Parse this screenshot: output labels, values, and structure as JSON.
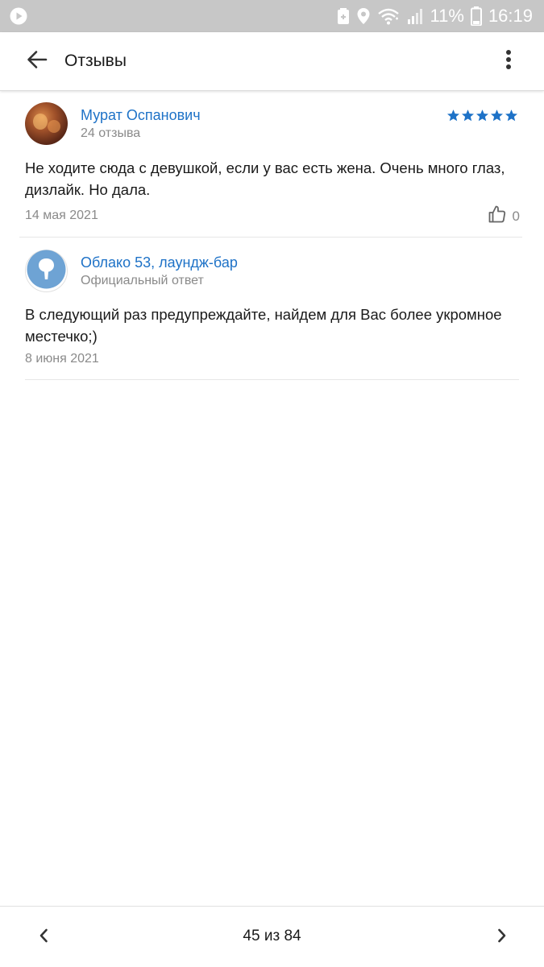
{
  "status_bar": {
    "battery_percent": "11%",
    "time": "16:19",
    "icons": [
      "play-icon",
      "battery-saver-icon",
      "location-icon",
      "wifi-icon",
      "signal-icon",
      "battery-icon"
    ]
  },
  "header": {
    "title": "Отзывы",
    "back_icon": "arrow-left-icon",
    "menu_icon": "more-vertical-icon"
  },
  "review": {
    "author_name": "Мурат Оспанович",
    "author_reviews_count": "24 отзыва",
    "rating": 5,
    "rating_max": 5,
    "text": "Не ходите сюда с девушкой, если у вас есть жена. Очень много глаз, дизлайк. Но дала.",
    "date": "14 мая 2021",
    "likes": "0",
    "like_icon": "thumbs-up-icon"
  },
  "response": {
    "org_name": "Облако 53, лаундж-бар",
    "label": "Официальный ответ",
    "text": "В следующий раз предупреждайте, найдем для Вас более укромное местечко;)",
    "date": "8 июня 2021"
  },
  "pagination": {
    "text": "45 из 84",
    "prev_icon": "chevron-left-icon",
    "next_icon": "chevron-right-icon"
  },
  "colors": {
    "accent": "#1e72c7",
    "star": "#1e72c7",
    "status_bar": "#c7c7c7",
    "org_avatar": "#6ea3d4",
    "secondary_text": "#8a8a8a"
  }
}
